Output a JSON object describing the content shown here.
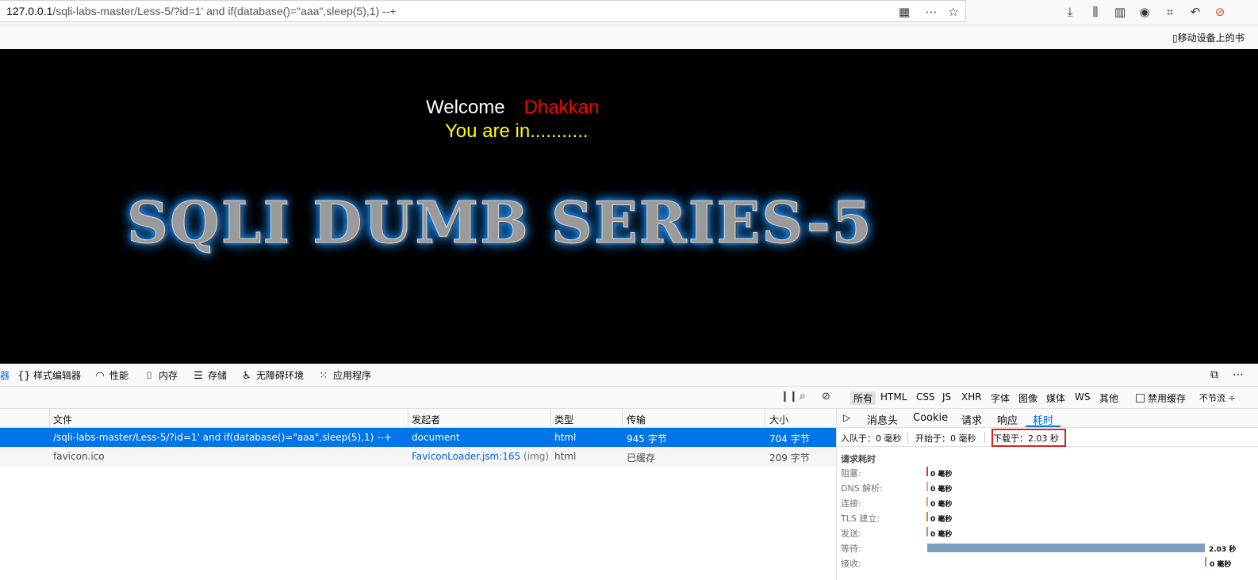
{
  "browser": {
    "url_host": "127.0.0.1",
    "url_path": "/sqli-labs-master/Less-5/?id=1' and if(database()=\"aaa\",sleep(5),1) --+",
    "mobile_bookmarks": "移动设备上的书"
  },
  "page": {
    "welcome": "Welcome",
    "name": "Dhakkan",
    "status": "You are in...........",
    "banner": "SQLI DUMB SERIES-5"
  },
  "devtools": {
    "tabs": [
      {
        "icon": "braces-icon",
        "label": "样式编辑器"
      },
      {
        "icon": "gauge-icon",
        "label": "性能"
      },
      {
        "icon": "chip-icon",
        "label": "内存"
      },
      {
        "icon": "storage-icon",
        "label": "存储"
      },
      {
        "icon": "accessibility-icon",
        "label": "无障碍环境"
      },
      {
        "icon": "grid-icon",
        "label": "应用程序"
      }
    ],
    "cut_tab_label": "器",
    "filters": [
      "所有",
      "HTML",
      "CSS",
      "JS",
      "XHR",
      "字体",
      "图像",
      "媒体",
      "WS",
      "其他"
    ],
    "disable_cache_label": "禁用缓存",
    "throttle_label": "不节流 ÷",
    "columns": {
      "file": "文件",
      "initiator": "发起者",
      "type": "类型",
      "transferred": "传输",
      "size": "大小"
    },
    "requests": [
      {
        "file": "/sqli-labs-master/Less-5/?id=1' and if(database()=\"aaa\",sleep(5),1) --+",
        "initiator": "document",
        "initiator_type": "",
        "type": "html",
        "transferred": "945 字节",
        "size": "704 字节"
      },
      {
        "file": "favicon.ico",
        "initiator": "FaviconLoader.jsm:165",
        "initiator_type": "(img)",
        "type": "html",
        "transferred": "已缓存",
        "size": "209 字节"
      }
    ],
    "side_tabs": [
      "消息头",
      "Cookie",
      "请求",
      "响应",
      "耗时"
    ],
    "summary": {
      "queued": "入队于：0 毫秒",
      "started": "开始于：0 毫秒",
      "downloaded": "下载于：2.03 秒"
    },
    "timing_title": "请求耗时",
    "timings": [
      {
        "label": "阻塞:",
        "value": "0 毫秒",
        "color": "#d13b3b"
      },
      {
        "label": "DNS 解析:",
        "value": "0 毫秒",
        "color": "#c7a1e0"
      },
      {
        "label": "连接:",
        "value": "0 毫秒",
        "color": "#f0a050"
      },
      {
        "label": "TLS 建立:",
        "value": "0 毫秒",
        "color": "#e08030"
      },
      {
        "label": "发送:",
        "value": "0 毫秒",
        "color": "#4fb4e0"
      },
      {
        "label": "等待:",
        "value": "2.03 秒",
        "color": "#7a9ec0"
      },
      {
        "label": "接收:",
        "value": "0 毫秒",
        "color": "#58c040"
      }
    ]
  }
}
